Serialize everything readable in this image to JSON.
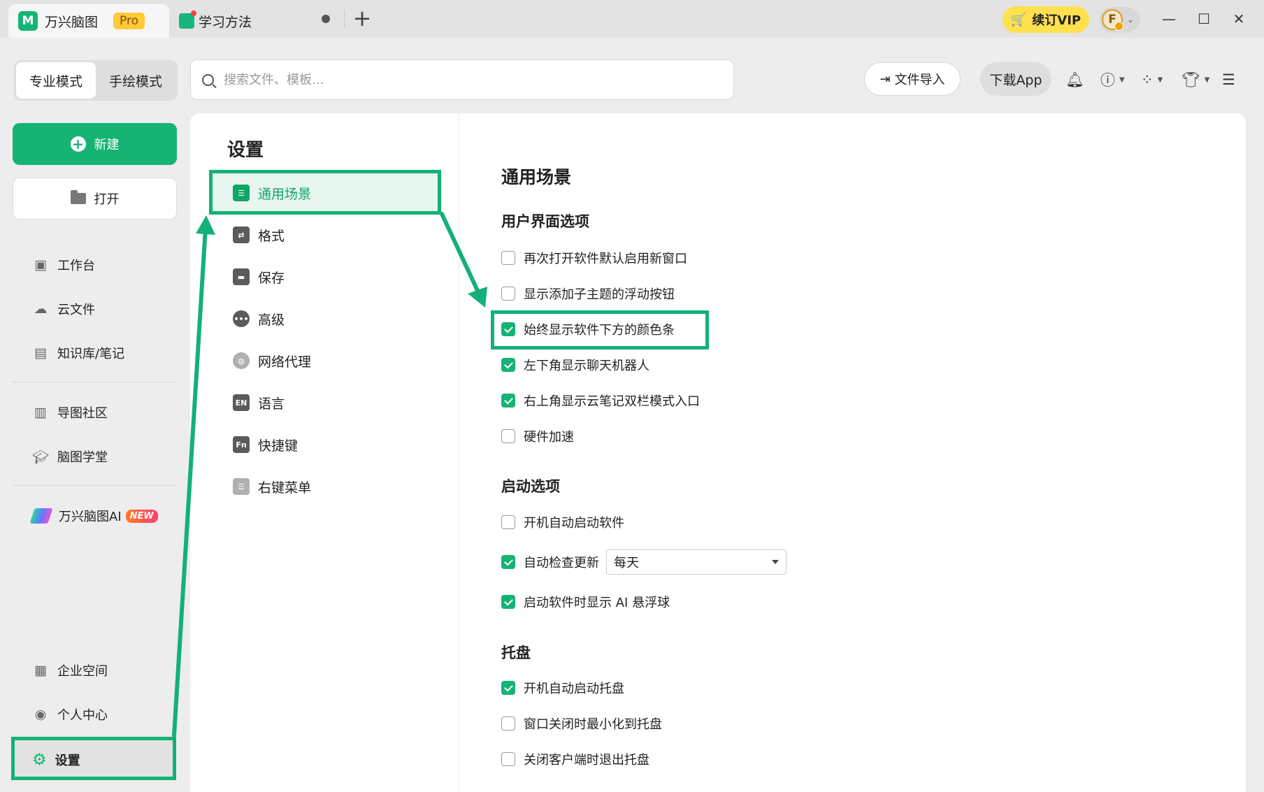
{
  "tabs": [
    {
      "label": "万兴脑图",
      "badge": "Pro"
    },
    {
      "label": "学习方法"
    }
  ],
  "titlebar": {
    "vip_label": "续订VIP",
    "avatar_initial": "F"
  },
  "toolbar": {
    "modes": [
      "专业模式",
      "手绘模式"
    ],
    "search_placeholder": "搜索文件、模板...",
    "import_label": "文件导入",
    "download_label": "下载App"
  },
  "sidebar": {
    "new_label": "新建",
    "open_label": "打开",
    "items": [
      {
        "label": "工作台",
        "icon": "workbench-icon"
      },
      {
        "label": "云文件",
        "icon": "cloud-icon"
      },
      {
        "label": "知识库/笔记",
        "icon": "notebook-icon"
      },
      {
        "label": "导图社区",
        "icon": "community-icon"
      },
      {
        "label": "脑图学堂",
        "icon": "graduation-cap-icon"
      },
      {
        "label": "万兴脑图AI",
        "icon": "ai-logo-icon",
        "badge": "NEW"
      },
      {
        "label": "企业空间",
        "icon": "enterprise-icon"
      },
      {
        "label": "个人中心",
        "icon": "user-icon"
      }
    ],
    "settings_label": "设置"
  },
  "settings": {
    "title": "设置",
    "categories": [
      {
        "label": "通用场景",
        "icon": "general-settings-icon"
      },
      {
        "label": "格式",
        "icon": "format-icon"
      },
      {
        "label": "保存",
        "icon": "save-icon"
      },
      {
        "label": "高级",
        "icon": "more-dots-icon"
      },
      {
        "label": "网络代理",
        "icon": "globe-icon"
      },
      {
        "label": "语言",
        "icon": "language-en-icon"
      },
      {
        "label": "快捷键",
        "icon": "shortcut-fn-icon"
      },
      {
        "label": "右键菜单",
        "icon": "context-menu-icon"
      }
    ],
    "active_category": "通用场景",
    "section_title": "通用场景",
    "groups": [
      {
        "title": "用户界面选项",
        "options": [
          {
            "label": "再次打开软件默认启用新窗口",
            "checked": false
          },
          {
            "label": "显示添加子主题的浮动按钮",
            "checked": false
          },
          {
            "label": "始终显示软件下方的颜色条",
            "checked": true
          },
          {
            "label": "左下角显示聊天机器人",
            "checked": true
          },
          {
            "label": "右上角显示云笔记双栏模式入口",
            "checked": true
          },
          {
            "label": "硬件加速",
            "checked": false
          }
        ]
      },
      {
        "title": "启动选项",
        "options": [
          {
            "label": "开机自动启动软件",
            "checked": false
          },
          {
            "label": "自动检查更新",
            "checked": true
          },
          {
            "label": "启动软件时显示 AI 悬浮球",
            "checked": true
          }
        ],
        "update_frequency": "每天"
      },
      {
        "title": "托盘",
        "options": [
          {
            "label": "开机自动启动托盘",
            "checked": true
          },
          {
            "label": "窗口关闭时最小化到托盘",
            "checked": false
          },
          {
            "label": "关闭客户端时退出托盘",
            "checked": false
          }
        ]
      }
    ]
  },
  "colors": {
    "accent": "#16b374",
    "annotation": "#13b177",
    "vip": "#ffe14d",
    "pro_badge": "#ffc93a"
  }
}
